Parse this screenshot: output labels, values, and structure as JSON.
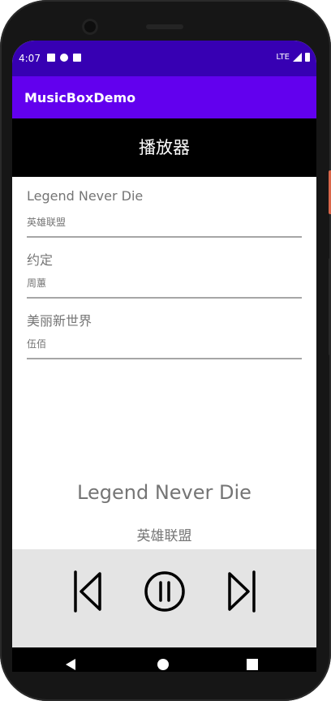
{
  "status_bar": {
    "time": "4:07",
    "network": "LTE",
    "left_icons": [
      "notification-icon",
      "app-icon",
      "sd-card-icon"
    ],
    "right_icons": [
      "signal-icon",
      "battery-icon"
    ]
  },
  "app_bar": {
    "title": "MusicBoxDemo",
    "color": "#6200ee",
    "status_color": "#3700b3"
  },
  "header": {
    "title": "播放器"
  },
  "songs": [
    {
      "title": "Legend Never Die",
      "artist": "英雄联盟"
    },
    {
      "title": "约定",
      "artist": "周蕙"
    },
    {
      "title": "美丽新世界",
      "artist": "伍佰"
    }
  ],
  "now_playing": {
    "title": "Legend Never Die",
    "artist": "英雄联盟"
  },
  "controls": [
    "previous-icon",
    "pause-icon",
    "next-icon"
  ],
  "system_nav": [
    "back-icon",
    "home-icon",
    "recents-icon"
  ]
}
